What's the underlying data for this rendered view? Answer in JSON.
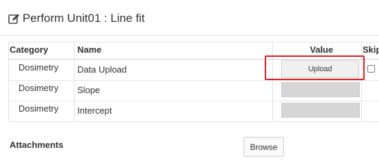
{
  "header": {
    "title": "Perform Unit01 : Line fit"
  },
  "table": {
    "columns": [
      "Category",
      "Name",
      "Value",
      "Skip"
    ],
    "rows": [
      {
        "category": "Dosimetry",
        "name": "Data Upload",
        "value_button": "Upload"
      },
      {
        "category": "Dosimetry",
        "name": "Slope"
      },
      {
        "category": "Dosimetry",
        "name": "Intercept"
      }
    ]
  },
  "attachments": {
    "label": "Attachments",
    "browse_label": "Browse"
  },
  "colors": {
    "highlight": "#e11a1a",
    "input_disabled": "#d6d6d6"
  },
  "icons": {
    "title_icon": "edit-icon"
  }
}
